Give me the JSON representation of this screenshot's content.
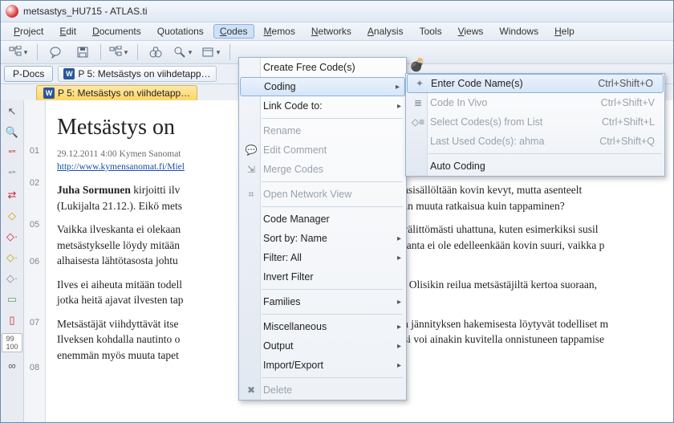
{
  "window": {
    "title": "metsastys_HU715 - ATLAS.ti"
  },
  "menubar": {
    "project": "Project",
    "edit": "Edit",
    "documents": "Documents",
    "quotations": "Quotations",
    "codes": "Codes",
    "memos": "Memos",
    "networks": "Networks",
    "analysis": "Analysis",
    "tools": "Tools",
    "views": "Views",
    "windows": "Windows",
    "help": "Help"
  },
  "toolbar": {
    "pdocs": "P-Docs"
  },
  "tabs": {
    "doc1": "P 5: Metsästys on viihdetapp…",
    "doc1b": "P 5:  Metsästys on viihdetapp…"
  },
  "codes_menu": {
    "create_free": "Create Free Code(s)",
    "coding": "Coding",
    "link_code_to": "Link Code to:",
    "rename": "Rename",
    "edit_comment": "Edit Comment",
    "merge_codes": "Merge Codes",
    "open_network_view": "Open Network View",
    "code_manager": "Code Manager",
    "sort_by": "Sort by: Name",
    "filter": "Filter: All",
    "invert_filter": "Invert Filter",
    "families": "Families",
    "miscellaneous": "Miscellaneous",
    "output": "Output",
    "import_export": "Import/Export",
    "delete": "Delete"
  },
  "coding_submenu": {
    "enter_code_names": "Enter Code Name(s)",
    "enter_sc": "Ctrl+Shift+O",
    "code_in_vivo": "Code In Vivo",
    "vivo_sc": "Ctrl+Shift+V",
    "select_from_list": "Select Codes(s) from List",
    "select_sc": "Ctrl+Shift+L",
    "last_used": "Last Used Code(s): ahma",
    "last_sc": "Ctrl+Shift+Q",
    "auto_coding": "Auto Coding"
  },
  "document": {
    "headline": "Metsästys on",
    "date": "29.12.2011 4:00 Kymen Sanomat",
    "url_label": "http://www.kymensanomat.fi/Miel",
    "p1a": "Juha Sormunen",
    "p1b": " kirjoitti ilv",
    "p1c": "oka oli asiasisällöltään kovin kevyt, mutta asenteelt",
    "p2": "(Lukijalta 21.12.). Eikö mets",
    "p2b": "än asiaan muuta ratkaisua kuin tappaminen?",
    "p3a": "Vaikka ilveskanta ei olekaan",
    "p3b": "vuoksi välittömästi uhattuna, kuten esimerkiksi susil",
    "p4a": "metsästykselle löydy mitään",
    "p4b": "teita. Kanta ei ole edelleenkään kovin suuri, vaikka p",
    "p5": "alhaisesta lähtötasosta johtu",
    "p6a": "Ilves ei aiheuta mitään todell",
    "p6b": "kissoille. Olisikin reilua metsästäjiltä kertoa suoraan,",
    "p7": "jotka heitä ajavat ilvesten tap",
    "p8a": "Metsästäjät viihdyttävät itse",
    "p8b": "nteen ja jännityksen hakemisesta löytyvät todelliset m",
    "p9a": "Ilveksen kohdalla nautinto o",
    "p9b": "n lisäksi voi ainakin kuvitella onnistuneen tappamise",
    "p10": "enemmän myös muuta tapet"
  },
  "gutter": [
    "01",
    "02",
    "05",
    "06",
    "07",
    "08"
  ]
}
